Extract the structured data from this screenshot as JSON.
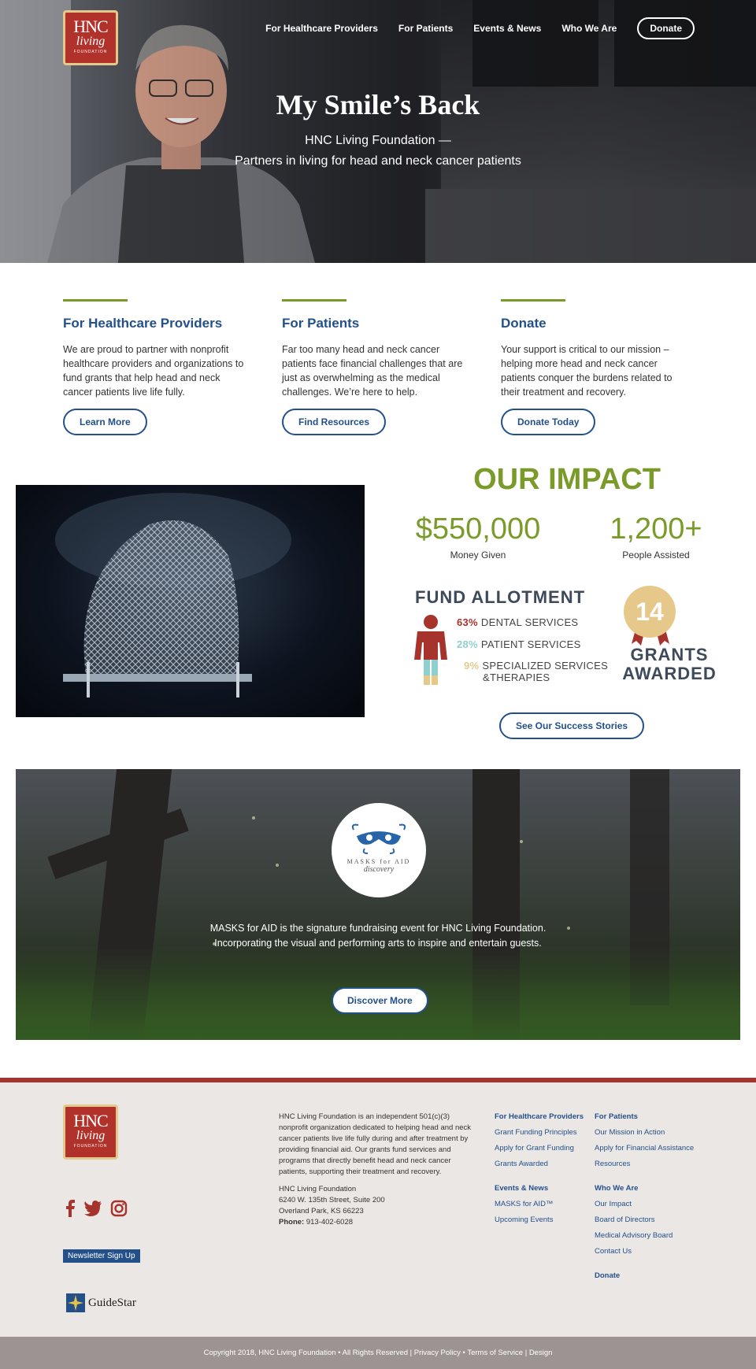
{
  "brand": {
    "logo_line1": "HNC",
    "logo_line2": "living",
    "logo_line3": "FOUNDATION",
    "colors": {
      "navy": "#24508a",
      "green": "#7a9a2a",
      "red": "#a6332c",
      "gold": "#e6c98a"
    }
  },
  "nav": {
    "items": [
      "For Healthcare Providers",
      "For Patients",
      "Events & News",
      "Who We Are"
    ],
    "donate": "Donate"
  },
  "hero": {
    "title": "My Smile’s Back",
    "sub1": "HNC Living Foundation —",
    "sub2": "Partners in living for head and neck cancer patients"
  },
  "columns": [
    {
      "title": "For Healthcare Providers",
      "text": "We are proud to partner with nonprofit healthcare providers and organizations to fund grants that help head and neck cancer patients live life fully.",
      "button": "Learn More"
    },
    {
      "title": "For Patients",
      "text": "Far too many head and neck cancer patients face financial challenges that are just as overwhelming as the medical challenges. We’re here to help.",
      "button": "Find Resources"
    },
    {
      "title": "Donate",
      "text": "Your support is critical to our mission – helping more head and neck cancer patients conquer the burdens related to their treatment and recovery.",
      "button": "Donate Today"
    }
  ],
  "impact": {
    "title": "OUR IMPACT",
    "money": "$550,000",
    "money_label": "Money Given",
    "people": "1,200+",
    "people_label": "People Assisted",
    "fund_title": "FUND ALLOTMENT",
    "fund": [
      {
        "pct": "63%",
        "label": "DENTAL SERVICES",
        "color": "#a6332c"
      },
      {
        "pct": "28%",
        "label": "PATIENT SERVICES",
        "color": "#8fd0cf"
      },
      {
        "pct": "9%",
        "label": "SPECIALIZED SERVICES",
        "label2": "&THERAPIES",
        "color": "#e6c98a"
      }
    ],
    "grants_number": "14",
    "grants_line1": "GRANTS",
    "grants_line2": "AWARDED",
    "button": "See Our Success Stories"
  },
  "masks": {
    "logo_text": "MASKS for AID",
    "logo_sub": "discovery",
    "line1": "MASKS for AID is the signature fundraising event for HNC Living Foundation.",
    "line2": "Incorporating the visual and performing arts to inspire and entertain guests.",
    "button": "Discover More"
  },
  "footer": {
    "about": "HNC Living Foundation is an independent 501(c)(3) nonprofit organization dedicated to helping head and neck cancer patients live life fully during and after treatment by providing financial aid. Our grants fund services and programs that directly benefit head and neck cancer patients, supporting their treatment and recovery.",
    "address_name": "HNC Living Foundation",
    "address1": "6240 W. 135th Street, Suite 200",
    "address2": "Overland Park, KS 66223",
    "phone_label": "Phone:",
    "phone": "913-402-6028",
    "newsletter": "Newsletter Sign Up",
    "guidestar": "GuideStar",
    "col1": {
      "heading": "For Healthcare Providers",
      "items": [
        "Grant Funding Principles",
        "Apply for Grant Funding",
        "Grants Awarded"
      ],
      "heading2": "Events & News",
      "items2": [
        "MASKS for AID™",
        "Upcoming Events"
      ]
    },
    "col2": {
      "heading": "For Patients",
      "items": [
        "Our Mission in Action",
        "Apply for Financial Assistance",
        "Resources"
      ],
      "heading2": "Who We Are",
      "items2": [
        "Our Impact",
        "Board of Directors",
        "Medical Advisory Board",
        "Contact Us"
      ],
      "donate": "Donate"
    },
    "copyright": "Copyright 2018, HNC Living Foundation • All Rights Reserved | Privacy Policy • Terms of Service | Design"
  }
}
